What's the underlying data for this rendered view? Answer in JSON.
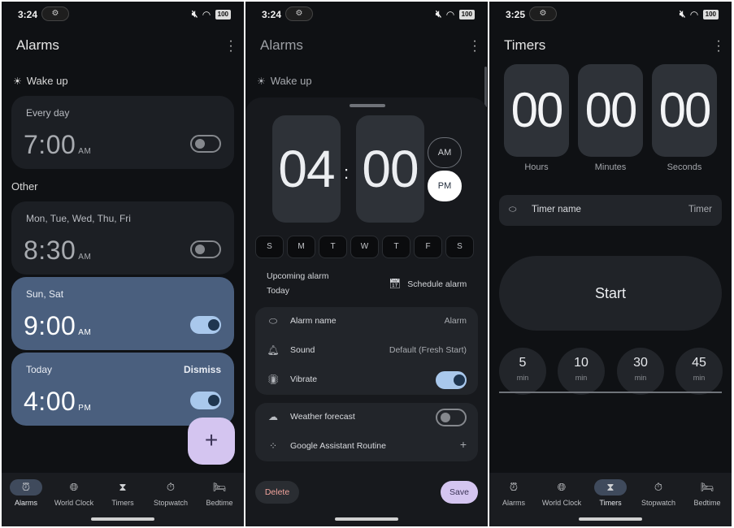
{
  "screens": [
    {
      "status": {
        "time": "3:24",
        "battery": "100"
      },
      "title": "Alarms",
      "wake_section": "Wake up",
      "other_section": "Other",
      "alarms": [
        {
          "days": "Every day",
          "time": "7:00",
          "ampm": "AM",
          "enabled": false
        },
        {
          "days": "Mon, Tue, Wed, Thu, Fri",
          "time": "8:30",
          "ampm": "AM",
          "enabled": false
        },
        {
          "days": "Sun, Sat",
          "time": "9:00",
          "ampm": "AM",
          "enabled": true
        },
        {
          "days": "Today",
          "time": "4:00",
          "ampm": "PM",
          "enabled": true,
          "action": "Dismiss"
        }
      ],
      "fab_icon": "+"
    },
    {
      "status": {
        "time": "3:24",
        "battery": "100"
      },
      "title": "Alarms",
      "wake_section": "Wake up",
      "editor": {
        "hour": "04",
        "minute": "00",
        "am": "AM",
        "pm": "PM",
        "selected_period": "PM",
        "days": [
          "S",
          "M",
          "T",
          "W",
          "T",
          "F",
          "S"
        ],
        "upcoming_label": "Upcoming alarm",
        "upcoming_value": "Today",
        "schedule_label": "Schedule alarm",
        "alarm_name_label": "Alarm name",
        "alarm_name_value": "Alarm",
        "sound_label": "Sound",
        "sound_value": "Default (Fresh Start)",
        "vibrate_label": "Vibrate",
        "vibrate_on": true,
        "weather_label": "Weather forecast",
        "weather_on": false,
        "assistant_label": "Google Assistant Routine",
        "assistant_add": "+",
        "delete_label": "Delete",
        "save_label": "Save"
      }
    },
    {
      "status": {
        "time": "3:25",
        "battery": "100"
      },
      "title": "Timers",
      "timer": {
        "hours": "00",
        "minutes": "00",
        "seconds": "00",
        "hours_label": "Hours",
        "minutes_label": "Minutes",
        "seconds_label": "Seconds",
        "name_label": "Timer name",
        "name_value": "Timer",
        "start_label": "Start",
        "presets": [
          {
            "value": "5",
            "unit": "min"
          },
          {
            "value": "10",
            "unit": "min"
          },
          {
            "value": "30",
            "unit": "min"
          },
          {
            "value": "45",
            "unit": "min"
          }
        ]
      }
    }
  ],
  "nav": [
    "Alarms",
    "World Clock",
    "Timers",
    "Stopwatch",
    "Bedtime"
  ],
  "nav_icons": [
    "alarm-icon",
    "globe-icon",
    "hourglass-icon",
    "stopwatch-icon",
    "bed-icon"
  ],
  "colors": {
    "background": "#0f1114",
    "active_card": "#4a5f7e",
    "fab": "#d4c5f0",
    "toggle_on": "#a9c8ec"
  }
}
